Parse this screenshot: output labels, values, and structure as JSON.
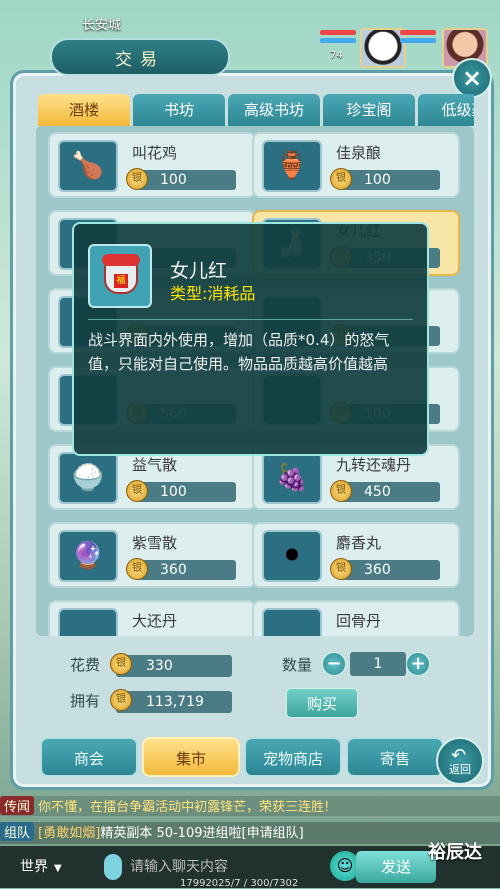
{
  "hud": {
    "city": "长安城",
    "level": "74"
  },
  "panel": {
    "title": "交易",
    "close_icon": "×"
  },
  "tabs": [
    "酒楼",
    "书坊",
    "高级书坊",
    "珍宝阁",
    "低级药"
  ],
  "items": [
    {
      "name": "叫花鸡",
      "price": "100",
      "icon": "🍗"
    },
    {
      "name": "佳泉酿",
      "price": "100",
      "icon": "🏺"
    },
    {
      "name": "",
      "price": "",
      "icon": ""
    },
    {
      "name": "女儿红",
      "price": "330",
      "icon": "🍶"
    },
    {
      "name": "",
      "price": "",
      "icon": ""
    },
    {
      "name": "",
      "price": "",
      "icon": ""
    },
    {
      "name": "",
      "price": "560",
      "icon": ""
    },
    {
      "name": "",
      "price": "100",
      "icon": ""
    },
    {
      "name": "益气散",
      "price": "100",
      "icon": "🍚"
    },
    {
      "name": "九转还魂丹",
      "price": "450",
      "icon": "🍇"
    },
    {
      "name": "紫雪散",
      "price": "360",
      "icon": "🔮"
    },
    {
      "name": "麝香丸",
      "price": "360",
      "icon": "⚫"
    },
    {
      "name": "大还丹",
      "price": "",
      "icon": ""
    },
    {
      "name": "回骨丹",
      "price": "",
      "icon": ""
    }
  ],
  "purchase": {
    "cost_label": "花费",
    "cost_value": "330",
    "own_label": "拥有",
    "own_value": "113,719",
    "qty_label": "数量",
    "qty_value": "1",
    "minus": "−",
    "plus": "+",
    "buy_label": "购买"
  },
  "coin_glyph": "银",
  "bottom_tabs": [
    "商会",
    "集市",
    "宠物商店",
    "寄售"
  ],
  "back_label": "返回",
  "back_arrow": "↶",
  "chat": {
    "line1_tag": "传闻",
    "line1_text": "你不懂，在擂台争霸活动中初露锋芒，荣获三连胜!",
    "line2_tag": "组队",
    "line2_link": "[勇敢如烟]",
    "line2_text": "精英副本 50-109进组啦[申请组队]",
    "channel": "世界",
    "placeholder": "请输入聊天内容",
    "send": "发送"
  },
  "watermark": "裕辰达",
  "coords": "17992025/7 / 300/7302",
  "tooltip": {
    "name": "女儿红",
    "type": "类型:消耗品",
    "description": "战斗界面内外使用，增加（品质*0.4）的怒气值，只能对自己使用。物品品质越高价值越高",
    "jar_label": "福"
  }
}
